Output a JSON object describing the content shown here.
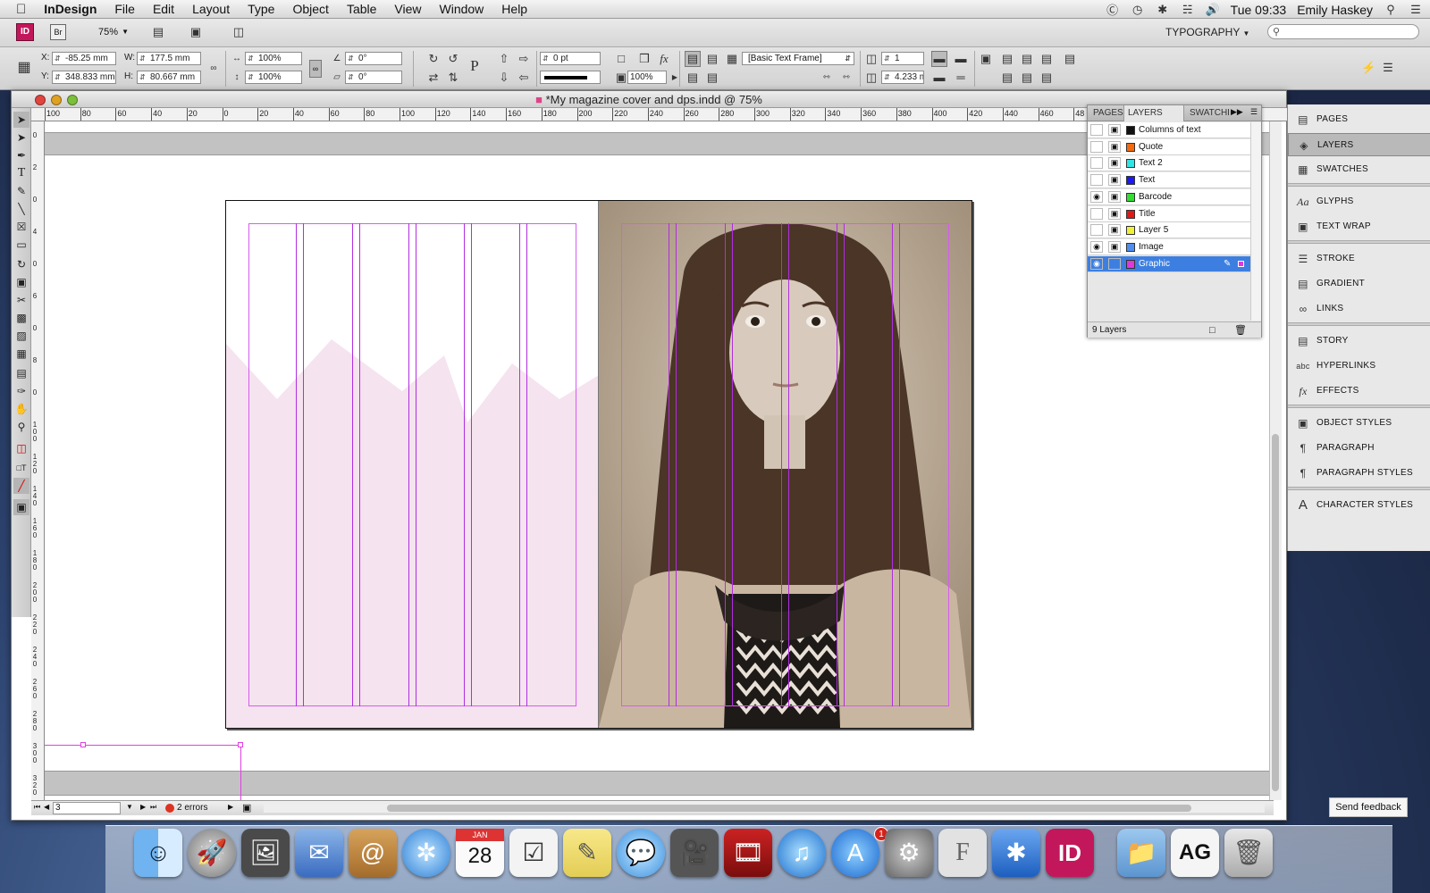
{
  "menubar": {
    "apple_icon": "apple-icon",
    "app_name": "InDesign",
    "items": [
      "File",
      "Edit",
      "Layout",
      "Type",
      "Object",
      "Table",
      "View",
      "Window",
      "Help"
    ],
    "clock": "Tue 09:33",
    "user": "Emily Haskey"
  },
  "app_bar": {
    "id_badge": "ID",
    "br_badge": "Br",
    "zoom": "75%",
    "workspace": "TYPOGRAPHY",
    "search_placeholder": ""
  },
  "control_panel": {
    "x_label": "X:",
    "x_value": "-85.25 mm",
    "y_label": "Y:",
    "y_value": "348.833 mm",
    "w_label": "W:",
    "w_value": "177.5 mm",
    "h_label": "H:",
    "h_value": "80.667 mm",
    "scale_x": "100%",
    "scale_y": "100%",
    "rotate": "0°",
    "shear": "0°",
    "stroke_weight": "0 pt",
    "opacity": "100%",
    "object_style": "[Basic Text Frame]",
    "columns": "1",
    "gutter": "4.233 m"
  },
  "document": {
    "title": "*My magazine cover and dps.indd @ 75%",
    "ruler_top": [
      "100",
      "80",
      "60",
      "40",
      "20",
      "0",
      "20",
      "40",
      "60",
      "80",
      "100",
      "120",
      "140",
      "160",
      "180",
      "200",
      "220",
      "240",
      "260",
      "280",
      "300",
      "320",
      "340",
      "360",
      "380",
      "400",
      "420",
      "440",
      "460",
      "48"
    ],
    "ruler_left": [
      "0",
      "2",
      "0",
      "4",
      "0",
      "6",
      "0",
      "8",
      "0",
      "1 0 0",
      "1 2 0",
      "1 4 0",
      "1 6 0",
      "1 8 0",
      "2 0 0",
      "2 2 0",
      "2 4 0",
      "2 6 0",
      "2 8 0",
      "3 0 0",
      "3 2 0"
    ],
    "page_field": "3",
    "errors": "2 errors"
  },
  "layers_panel": {
    "tabs": [
      "PAGES",
      "LAYERS",
      "SWATCHES"
    ],
    "layers": [
      {
        "name": "Columns of text",
        "color": "#111111",
        "visible": false
      },
      {
        "name": "Quote",
        "color": "#f36a10",
        "visible": false
      },
      {
        "name": "Text 2",
        "color": "#2ee6e6",
        "visible": false
      },
      {
        "name": "Text",
        "color": "#1a1af0",
        "visible": false
      },
      {
        "name": "Barcode",
        "color": "#33dd33",
        "visible": true
      },
      {
        "name": "Title",
        "color": "#e01818",
        "visible": false
      },
      {
        "name": "Layer 5",
        "color": "#f0f03a",
        "visible": false
      },
      {
        "name": "Image",
        "color": "#4f8ef0",
        "visible": true
      },
      {
        "name": "Graphic",
        "color": "#e036e0",
        "visible": true,
        "selected": true
      }
    ],
    "footer": "9 Layers"
  },
  "dock_panel": {
    "items": [
      "PAGES",
      "LAYERS",
      "SWATCHES",
      "GLYPHS",
      "TEXT WRAP",
      "STROKE",
      "GRADIENT",
      "LINKS",
      "STORY",
      "HYPERLINKS",
      "EFFECTS",
      "OBJECT STYLES",
      "PARAGRAPH",
      "PARAGRAPH STYLES",
      "CHARACTER STYLES"
    ]
  },
  "dock": {
    "calendar_month": "JAN",
    "calendar_day": "28",
    "appstore_badge": "1",
    "indesign_label": "ID",
    "ag_label": "AG"
  },
  "feedback": "Send feedback"
}
